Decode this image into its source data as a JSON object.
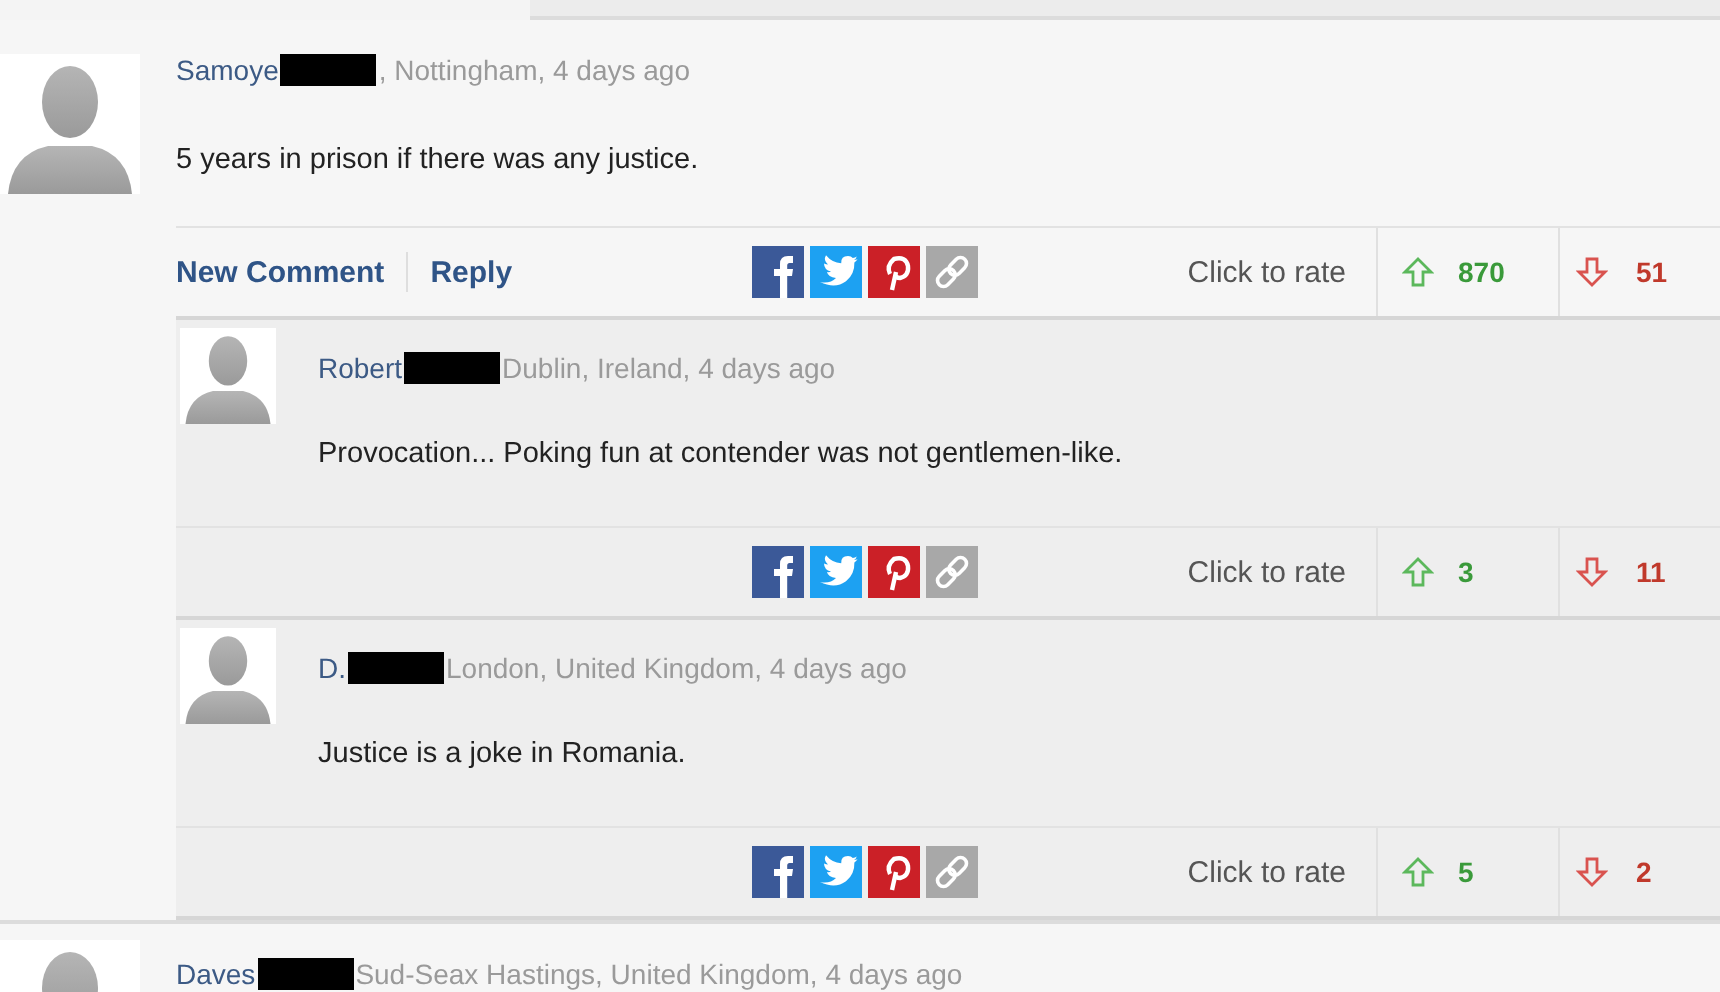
{
  "comments": [
    {
      "author": "Samoye",
      "redacted": true,
      "meta": ", Nottingham, 4 days ago",
      "body": "5 years in prison if there was any justice.",
      "actions": [
        "New Comment",
        "Reply"
      ],
      "rate_label": "Click to rate",
      "up": "870",
      "down": "51",
      "children": [
        {
          "author": "Robert",
          "redacted": true,
          "meta": "Dublin, Ireland, 4 days ago",
          "body": "Provocation... Poking fun at contender was not gentlemen-like.",
          "rate_label": "Click to rate",
          "up": "3",
          "down": "11"
        },
        {
          "author": "D.",
          "redacted": true,
          "meta": "London, United Kingdom, 4 days ago",
          "body": "Justice is a joke in Romania.",
          "rate_label": "Click to rate",
          "up": "5",
          "down": "2"
        }
      ]
    },
    {
      "author": "Daves",
      "redacted": true,
      "meta": "Sud-Seax Hastings, United Kingdom, 4 days ago"
    }
  ]
}
